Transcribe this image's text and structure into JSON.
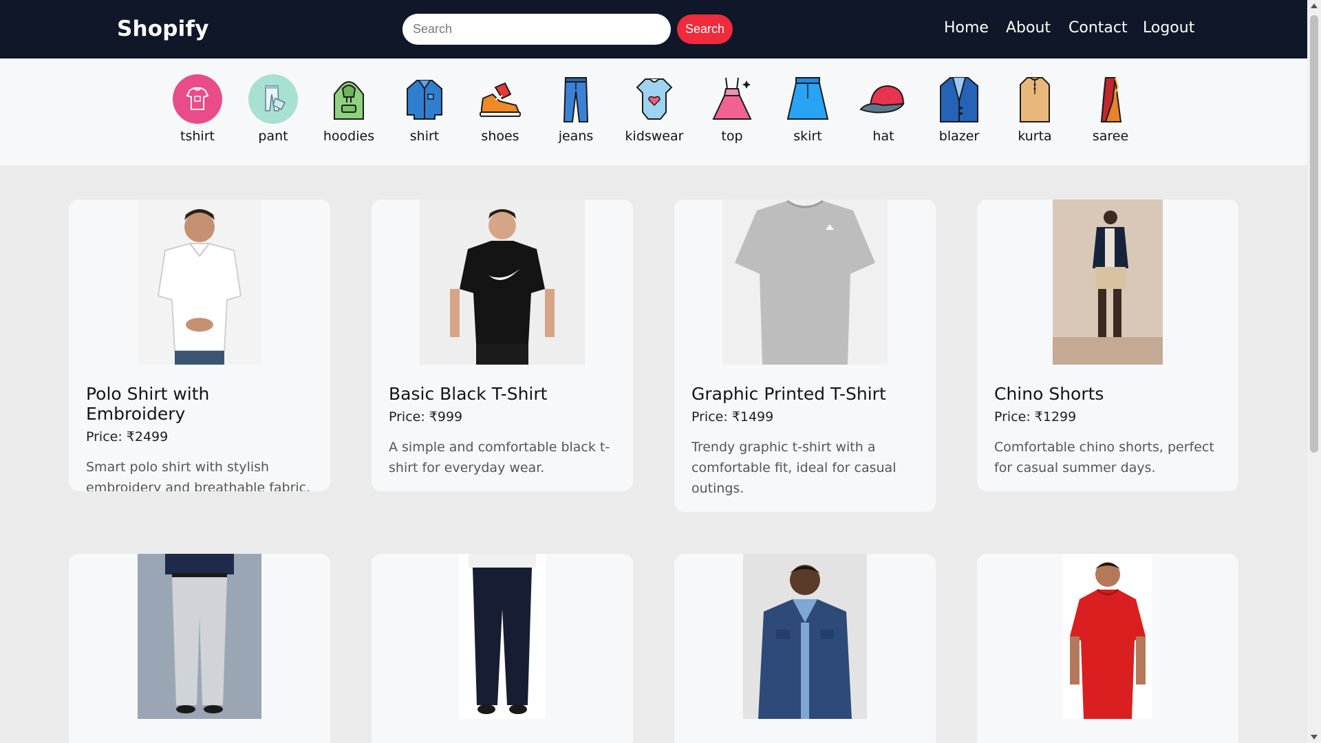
{
  "header": {
    "brand": "Shopify",
    "search_placeholder": "Search",
    "search_button": "Search",
    "nav": [
      "Home",
      "About",
      "Contact",
      "Logout"
    ]
  },
  "categories": [
    {
      "label": "tshirt",
      "icon": "tshirt-icon"
    },
    {
      "label": "pant",
      "icon": "pant-icon"
    },
    {
      "label": "hoodies",
      "icon": "hoodie-icon"
    },
    {
      "label": "shirt",
      "icon": "shirt-icon"
    },
    {
      "label": "shoes",
      "icon": "shoes-icon"
    },
    {
      "label": "jeans",
      "icon": "jeans-icon"
    },
    {
      "label": "kidswear",
      "icon": "kidswear-icon"
    },
    {
      "label": "top",
      "icon": "top-icon"
    },
    {
      "label": "skirt",
      "icon": "skirt-icon"
    },
    {
      "label": "hat",
      "icon": "hat-icon"
    },
    {
      "label": "blazer",
      "icon": "blazer-icon"
    },
    {
      "label": "kurta",
      "icon": "kurta-icon"
    },
    {
      "label": "saree",
      "icon": "saree-icon"
    }
  ],
  "products": [
    {
      "title": "Polo Shirt with Embroidery",
      "price": "Price: ₹2499",
      "description": "Smart polo shirt with stylish embroidery and breathable fabric."
    },
    {
      "title": "Basic Black T-Shirt",
      "price": "Price: ₹999",
      "description": "A simple and comfortable black t-shirt for everyday wear."
    },
    {
      "title": "Graphic Printed T-Shirt",
      "price": "Price: ₹1499",
      "description": "Trendy graphic t-shirt with a comfortable fit, ideal for casual outings."
    },
    {
      "title": "Chino Shorts",
      "price": "Price: ₹1299",
      "description": "Comfortable chino shorts, perfect for casual summer days."
    },
    {
      "title": "",
      "price": "",
      "description": ""
    },
    {
      "title": "",
      "price": "",
      "description": ""
    },
    {
      "title": "",
      "price": "",
      "description": ""
    },
    {
      "title": "",
      "price": "",
      "description": ""
    }
  ],
  "colors": {
    "header_bg": "#0f1729",
    "accent_red": "#ef2b3c",
    "card_bg": "#f7f8fa",
    "page_bg": "#ebebeb"
  }
}
